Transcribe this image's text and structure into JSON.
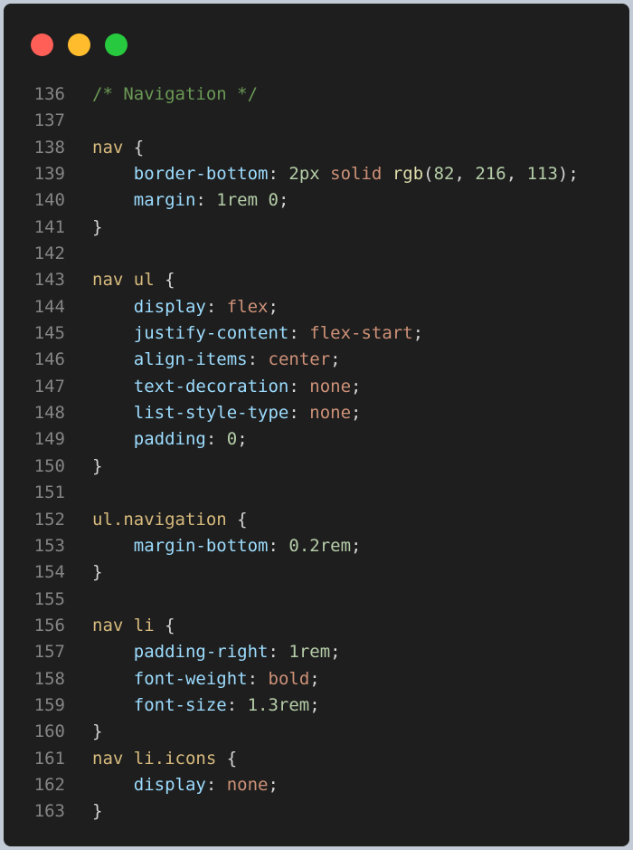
{
  "window": {
    "traffic_lights": [
      "close",
      "minimize",
      "maximize"
    ],
    "colors": {
      "close": "#ff5f56",
      "minimize": "#ffbd2e",
      "maximize": "#27c93f",
      "background": "#1e1e1e"
    }
  },
  "editor": {
    "lines": [
      {
        "n": "136",
        "tokens": [
          {
            "t": "comment",
            "v": "/* Navigation */"
          }
        ]
      },
      {
        "n": "137",
        "tokens": []
      },
      {
        "n": "138",
        "tokens": [
          {
            "t": "sel",
            "v": "nav"
          },
          {
            "t": "punct",
            "v": " {"
          }
        ]
      },
      {
        "n": "139",
        "tokens": [
          {
            "t": "punct",
            "v": "    "
          },
          {
            "t": "prop",
            "v": "border-bottom"
          },
          {
            "t": "punct",
            "v": ": "
          },
          {
            "t": "num",
            "v": "2px"
          },
          {
            "t": "punct",
            "v": " "
          },
          {
            "t": "kw",
            "v": "solid"
          },
          {
            "t": "punct",
            "v": " "
          },
          {
            "t": "fn",
            "v": "rgb"
          },
          {
            "t": "punct",
            "v": "("
          },
          {
            "t": "num",
            "v": "82"
          },
          {
            "t": "punct",
            "v": ", "
          },
          {
            "t": "num",
            "v": "216"
          },
          {
            "t": "punct",
            "v": ", "
          },
          {
            "t": "num",
            "v": "113"
          },
          {
            "t": "punct",
            "v": ");"
          }
        ]
      },
      {
        "n": "140",
        "tokens": [
          {
            "t": "punct",
            "v": "    "
          },
          {
            "t": "prop",
            "v": "margin"
          },
          {
            "t": "punct",
            "v": ": "
          },
          {
            "t": "num",
            "v": "1rem"
          },
          {
            "t": "punct",
            "v": " "
          },
          {
            "t": "num",
            "v": "0"
          },
          {
            "t": "punct",
            "v": ";"
          }
        ]
      },
      {
        "n": "141",
        "tokens": [
          {
            "t": "punct",
            "v": "}"
          }
        ]
      },
      {
        "n": "142",
        "tokens": []
      },
      {
        "n": "143",
        "tokens": [
          {
            "t": "sel",
            "v": "nav ul"
          },
          {
            "t": "punct",
            "v": " {"
          }
        ]
      },
      {
        "n": "144",
        "tokens": [
          {
            "t": "punct",
            "v": "    "
          },
          {
            "t": "prop",
            "v": "display"
          },
          {
            "t": "punct",
            "v": ": "
          },
          {
            "t": "kw",
            "v": "flex"
          },
          {
            "t": "punct",
            "v": ";"
          }
        ]
      },
      {
        "n": "145",
        "tokens": [
          {
            "t": "punct",
            "v": "    "
          },
          {
            "t": "prop",
            "v": "justify-content"
          },
          {
            "t": "punct",
            "v": ": "
          },
          {
            "t": "kw",
            "v": "flex-start"
          },
          {
            "t": "punct",
            "v": ";"
          }
        ]
      },
      {
        "n": "146",
        "tokens": [
          {
            "t": "punct",
            "v": "    "
          },
          {
            "t": "prop",
            "v": "align-items"
          },
          {
            "t": "punct",
            "v": ": "
          },
          {
            "t": "kw",
            "v": "center"
          },
          {
            "t": "punct",
            "v": ";"
          }
        ]
      },
      {
        "n": "147",
        "tokens": [
          {
            "t": "punct",
            "v": "    "
          },
          {
            "t": "prop",
            "v": "text-decoration"
          },
          {
            "t": "punct",
            "v": ": "
          },
          {
            "t": "kw",
            "v": "none"
          },
          {
            "t": "punct",
            "v": ";"
          }
        ]
      },
      {
        "n": "148",
        "tokens": [
          {
            "t": "punct",
            "v": "    "
          },
          {
            "t": "prop",
            "v": "list-style-type"
          },
          {
            "t": "punct",
            "v": ": "
          },
          {
            "t": "kw",
            "v": "none"
          },
          {
            "t": "punct",
            "v": ";"
          }
        ]
      },
      {
        "n": "149",
        "tokens": [
          {
            "t": "punct",
            "v": "    "
          },
          {
            "t": "prop",
            "v": "padding"
          },
          {
            "t": "punct",
            "v": ": "
          },
          {
            "t": "num",
            "v": "0"
          },
          {
            "t": "punct",
            "v": ";"
          }
        ]
      },
      {
        "n": "150",
        "tokens": [
          {
            "t": "punct",
            "v": "}"
          }
        ]
      },
      {
        "n": "151",
        "tokens": []
      },
      {
        "n": "152",
        "tokens": [
          {
            "t": "sel",
            "v": "ul.navigation"
          },
          {
            "t": "punct",
            "v": " {"
          }
        ]
      },
      {
        "n": "153",
        "tokens": [
          {
            "t": "punct",
            "v": "    "
          },
          {
            "t": "prop",
            "v": "margin-bottom"
          },
          {
            "t": "punct",
            "v": ": "
          },
          {
            "t": "num",
            "v": "0.2rem"
          },
          {
            "t": "punct",
            "v": ";"
          }
        ]
      },
      {
        "n": "154",
        "tokens": [
          {
            "t": "punct",
            "v": "}"
          }
        ]
      },
      {
        "n": "155",
        "tokens": []
      },
      {
        "n": "156",
        "tokens": [
          {
            "t": "sel",
            "v": "nav li"
          },
          {
            "t": "punct",
            "v": " {"
          }
        ]
      },
      {
        "n": "157",
        "tokens": [
          {
            "t": "punct",
            "v": "    "
          },
          {
            "t": "prop",
            "v": "padding-right"
          },
          {
            "t": "punct",
            "v": ": "
          },
          {
            "t": "num",
            "v": "1rem"
          },
          {
            "t": "punct",
            "v": ";"
          }
        ]
      },
      {
        "n": "158",
        "tokens": [
          {
            "t": "punct",
            "v": "    "
          },
          {
            "t": "prop",
            "v": "font-weight"
          },
          {
            "t": "punct",
            "v": ": "
          },
          {
            "t": "kw",
            "v": "bold"
          },
          {
            "t": "punct",
            "v": ";"
          }
        ]
      },
      {
        "n": "159",
        "tokens": [
          {
            "t": "punct",
            "v": "    "
          },
          {
            "t": "prop",
            "v": "font-size"
          },
          {
            "t": "punct",
            "v": ": "
          },
          {
            "t": "num",
            "v": "1.3rem"
          },
          {
            "t": "punct",
            "v": ";"
          }
        ]
      },
      {
        "n": "160",
        "tokens": [
          {
            "t": "punct",
            "v": "}"
          }
        ]
      },
      {
        "n": "161",
        "tokens": [
          {
            "t": "sel",
            "v": "nav li.icons"
          },
          {
            "t": "punct",
            "v": " {"
          }
        ]
      },
      {
        "n": "162",
        "tokens": [
          {
            "t": "punct",
            "v": "    "
          },
          {
            "t": "prop",
            "v": "display"
          },
          {
            "t": "punct",
            "v": ": "
          },
          {
            "t": "kw",
            "v": "none"
          },
          {
            "t": "punct",
            "v": ";"
          }
        ]
      },
      {
        "n": "163",
        "tokens": [
          {
            "t": "punct",
            "v": "}"
          }
        ]
      }
    ]
  }
}
